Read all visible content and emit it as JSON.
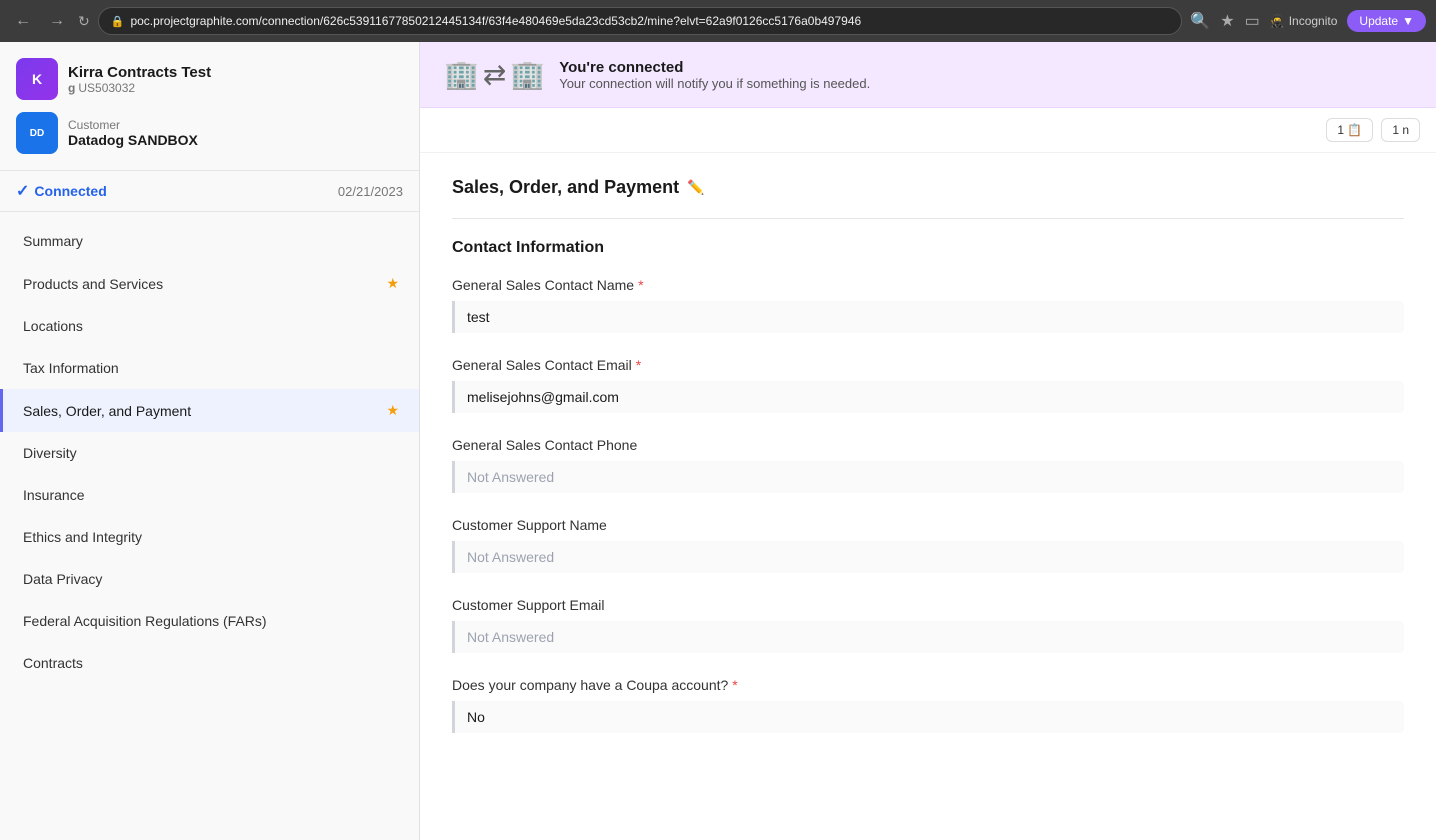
{
  "browser": {
    "url": "poc.projectgraphite.com/connection/626c53911677850212445134f/63f4e480469e5da23cd53cb2/mine?elvt=62a9f0126cc5176a0b497946",
    "url_short": "poc.projectgraphite.com",
    "incognito_label": "Incognito",
    "update_label": "Update"
  },
  "sidebar": {
    "org_name": "Kirra Contracts Test",
    "org_initials": "K",
    "org_id": "US503032",
    "customer_label": "Customer",
    "customer_name": "Datadog SANDBOX",
    "customer_initials": "DD",
    "connected_label": "Connected",
    "connected_date": "02/21/2023",
    "nav_items": [
      {
        "id": "summary",
        "label": "Summary",
        "has_badge": false,
        "active": false
      },
      {
        "id": "products-services",
        "label": "Products and Services",
        "has_badge": true,
        "active": false
      },
      {
        "id": "locations",
        "label": "Locations",
        "has_badge": false,
        "active": false
      },
      {
        "id": "tax-information",
        "label": "Tax Information",
        "has_badge": false,
        "active": false
      },
      {
        "id": "sales-order-payment",
        "label": "Sales, Order, and Payment",
        "has_badge": true,
        "active": true
      },
      {
        "id": "diversity",
        "label": "Diversity",
        "has_badge": false,
        "active": false
      },
      {
        "id": "insurance",
        "label": "Insurance",
        "has_badge": false,
        "active": false
      },
      {
        "id": "ethics-integrity",
        "label": "Ethics and Integrity",
        "has_badge": false,
        "active": false
      },
      {
        "id": "data-privacy",
        "label": "Data Privacy",
        "has_badge": false,
        "active": false
      },
      {
        "id": "federal-acquisition",
        "label": "Federal Acquisition Regulations (FARs)",
        "has_badge": false,
        "active": false
      },
      {
        "id": "contracts",
        "label": "Contracts",
        "has_badge": false,
        "active": false
      }
    ]
  },
  "banner": {
    "title": "You're connected",
    "subtitle": "Your connection will notify you if something is needed."
  },
  "toolbar": {
    "btn1_label": "1 📋",
    "btn2_label": "1 n"
  },
  "main": {
    "section_title": "Sales, Order, and Payment",
    "contact_section_title": "Contact Information",
    "fields": [
      {
        "id": "general-sales-contact-name",
        "label": "General Sales Contact Name",
        "required": true,
        "value": "test",
        "empty": false
      },
      {
        "id": "general-sales-contact-email",
        "label": "General Sales Contact Email",
        "required": true,
        "value": "melisejohns@gmail.com",
        "empty": false
      },
      {
        "id": "general-sales-contact-phone",
        "label": "General Sales Contact Phone",
        "required": false,
        "value": "Not Answered",
        "empty": true
      },
      {
        "id": "customer-support-name",
        "label": "Customer Support Name",
        "required": false,
        "value": "Not Answered",
        "empty": true
      },
      {
        "id": "customer-support-email",
        "label": "Customer Support Email",
        "required": false,
        "value": "Not Answered",
        "empty": true
      },
      {
        "id": "coupa-account",
        "label": "Does your company have a Coupa account?",
        "required": true,
        "value": "No",
        "empty": false
      }
    ]
  }
}
